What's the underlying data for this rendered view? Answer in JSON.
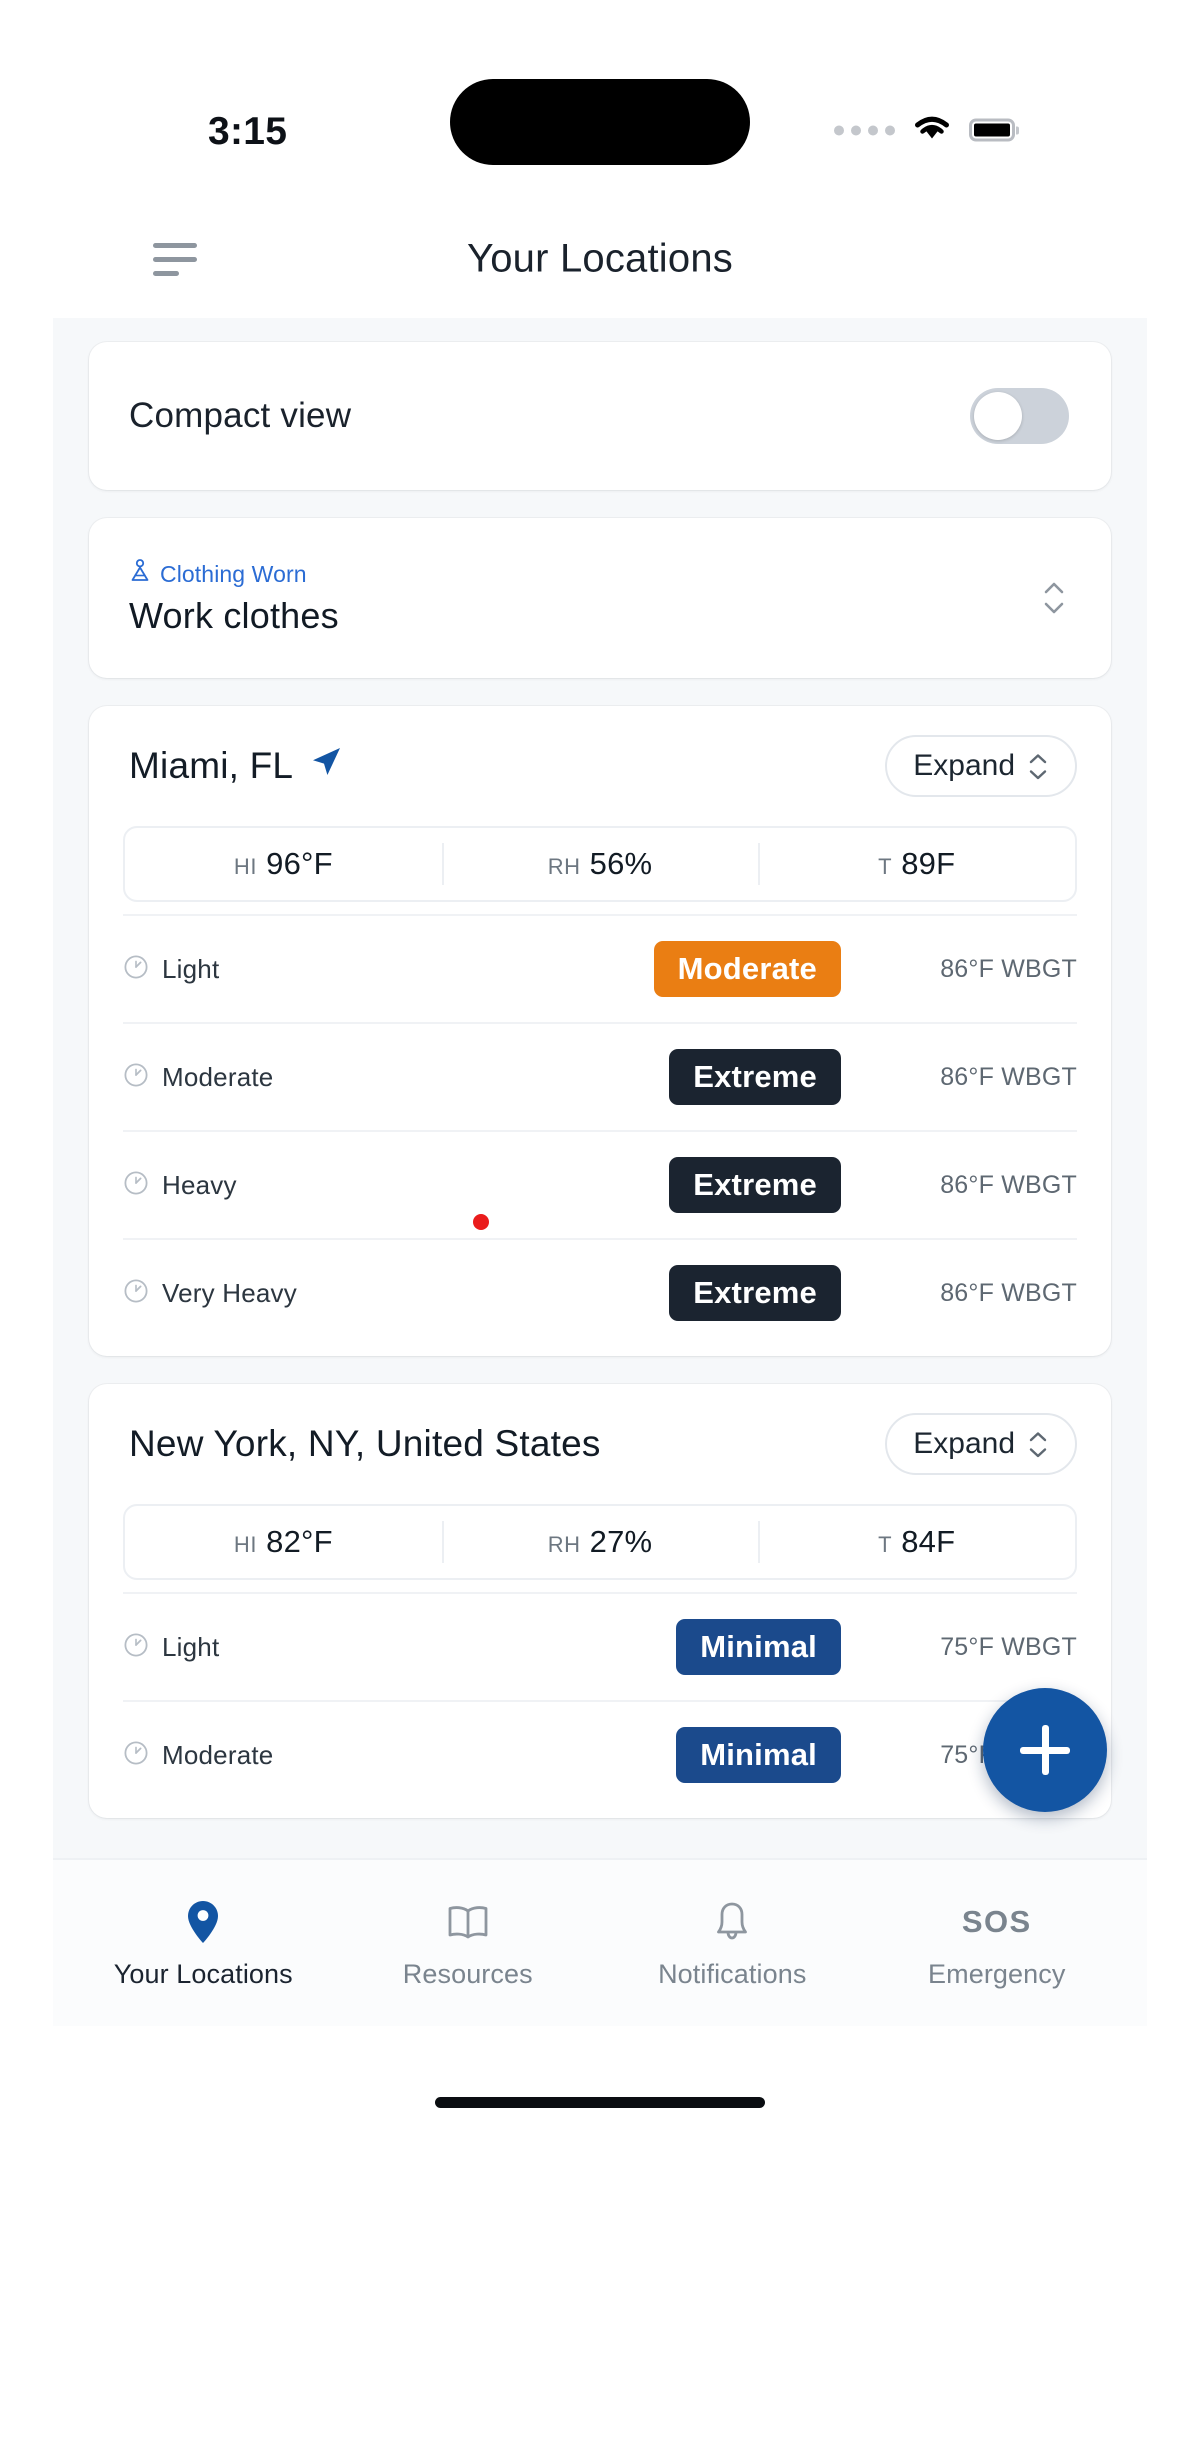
{
  "status_bar": {
    "time": "3:15",
    "signal_icon": "signal-dots-icon",
    "wifi_icon": "wifi-icon",
    "battery_icon": "battery-icon"
  },
  "app_bar": {
    "menu_icon": "hamburger-menu-icon",
    "title": "Your Locations"
  },
  "compact_view": {
    "label": "Compact view",
    "toggle_state": "off"
  },
  "clothing": {
    "icon": "person-clothing-icon",
    "tag": "Clothing Worn",
    "value": "Work clothes",
    "selector_icon": "chevron-up-down-icon"
  },
  "colors": {
    "accent_blue": "#1355a3",
    "link_blue": "#2b6cd4",
    "badge_moderate": "#ea7e13",
    "badge_extreme": "#1b2430",
    "badge_minimal": "#1b4a8c",
    "cursor_red": "#ea1c1c",
    "page_bg": "#f6f8fa"
  },
  "locations": [
    {
      "name": "Miami, FL",
      "has_location_arrow": true,
      "location_arrow_icon": "navigation-arrow-icon",
      "expand_label": "Expand",
      "expand_icon": "chevron-up-down-icon",
      "metrics": [
        {
          "key": "HI",
          "value": "96°F"
        },
        {
          "key": "RH",
          "value": "56%"
        },
        {
          "key": "T",
          "value": "89F"
        }
      ],
      "rows": [
        {
          "icon": "gauge-icon",
          "effort": "Light",
          "badge": "Moderate",
          "badge_level": "moderate",
          "wbgt": "86°F WBGT"
        },
        {
          "icon": "gauge-icon",
          "effort": "Moderate",
          "badge": "Extreme",
          "badge_level": "extreme",
          "wbgt": "86°F WBGT"
        },
        {
          "icon": "gauge-icon",
          "effort": "Heavy",
          "badge": "Extreme",
          "badge_level": "extreme",
          "wbgt": "86°F WBGT"
        },
        {
          "icon": "gauge-icon",
          "effort": "Very Heavy",
          "badge": "Extreme",
          "badge_level": "extreme",
          "wbgt": "86°F WBGT"
        }
      ]
    },
    {
      "name": "New York, NY, United States",
      "has_location_arrow": false,
      "location_arrow_icon": "",
      "expand_label": "Expand",
      "expand_icon": "chevron-up-down-icon",
      "metrics": [
        {
          "key": "HI",
          "value": "82°F"
        },
        {
          "key": "RH",
          "value": "27%"
        },
        {
          "key": "T",
          "value": "84F"
        }
      ],
      "rows": [
        {
          "icon": "gauge-icon",
          "effort": "Light",
          "badge": "Minimal",
          "badge_level": "minimal",
          "wbgt": "75°F WBGT"
        },
        {
          "icon": "gauge-icon",
          "effort": "Moderate",
          "badge": "Minimal",
          "badge_level": "minimal",
          "wbgt": "75°F WBGT"
        }
      ]
    }
  ],
  "fab": {
    "icon": "plus-icon",
    "label": "Add location"
  },
  "bottom_nav": {
    "items": [
      {
        "icon": "map-pin-icon",
        "label": "Your Locations",
        "active": true
      },
      {
        "icon": "book-icon",
        "label": "Resources",
        "active": false
      },
      {
        "icon": "bell-icon",
        "label": "Notifications",
        "active": false
      },
      {
        "icon": "sos-icon",
        "label": "Emergency",
        "active": false,
        "glyph": "SOS"
      }
    ]
  }
}
